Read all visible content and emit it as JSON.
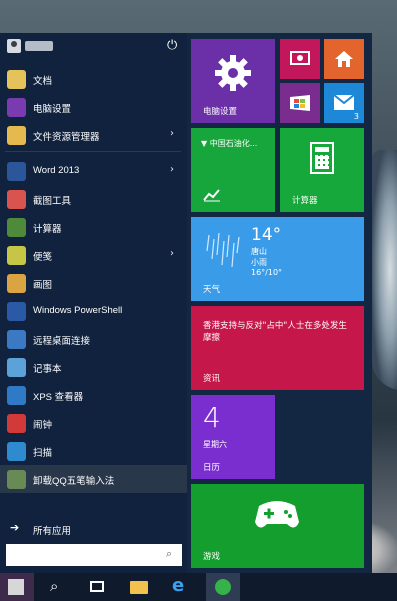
{
  "user": {
    "name_hidden": true
  },
  "menu_items": [
    {
      "label": "文档",
      "icon": "documents-icon",
      "color": "#e5c25a",
      "has_arrow": false
    },
    {
      "label": "电脑设置",
      "icon": "settings-icon",
      "color": "#7a3bb0",
      "has_arrow": false
    },
    {
      "label": "文件资源管理器",
      "icon": "file-explorer-icon",
      "color": "#e6b94f",
      "has_arrow": true
    },
    {
      "label": "Word 2013",
      "icon": "word-icon",
      "color": "#2b579a",
      "has_arrow": true
    },
    {
      "label": "截图工具",
      "icon": "snipping-tool-icon",
      "color": "#d9534f",
      "has_arrow": false
    },
    {
      "label": "计算器",
      "icon": "calculator-icon",
      "color": "#4e8a3a",
      "has_arrow": false
    },
    {
      "label": "便笺",
      "icon": "sticky-notes-icon",
      "color": "#c7c545",
      "has_arrow": true
    },
    {
      "label": "画图",
      "icon": "paint-icon",
      "color": "#d9a441",
      "has_arrow": false
    },
    {
      "label": "Windows PowerShell",
      "icon": "powershell-icon",
      "color": "#2a5aa6",
      "has_arrow": false
    },
    {
      "label": "远程桌面连接",
      "icon": "remote-desktop-icon",
      "color": "#3b79c5",
      "has_arrow": false
    },
    {
      "label": "记事本",
      "icon": "notepad-icon",
      "color": "#5aa2d8",
      "has_arrow": false
    },
    {
      "label": "XPS 查看器",
      "icon": "xps-viewer-icon",
      "color": "#2f7ac7",
      "has_arrow": false
    },
    {
      "label": "闹钟",
      "icon": "alarm-icon",
      "color": "#d23a3a",
      "has_arrow": false
    },
    {
      "label": "扫描",
      "icon": "scan-icon",
      "color": "#2e8bcf",
      "has_arrow": false
    },
    {
      "label": "卸载QQ五笔输入法",
      "icon": "uninstall-icon",
      "color": "#6a8a55",
      "has_arrow": false
    }
  ],
  "all_apps": {
    "label": "所有应用",
    "icon": "arrow-right-icon"
  },
  "search": {
    "value": "",
    "placeholder": "",
    "icon": "search-icon"
  },
  "tiles": {
    "settings": {
      "label": "电脑设置",
      "color": "#6b2fa8",
      "icon": "gear-icon"
    },
    "media": {
      "color": "#c2185b",
      "icon": "video-icon"
    },
    "home": {
      "color": "#e3652d",
      "icon": "home-icon"
    },
    "store": {
      "color": "#7b2c8f",
      "icon": "store-icon"
    },
    "mail": {
      "color": "#1e88d8",
      "icon": "mail-icon",
      "badge": "3"
    },
    "stock": {
      "headline": "▼ 中国石油化...",
      "color": "#17a63c",
      "icon": "chart-icon"
    },
    "calculator": {
      "label": "计算器",
      "color": "#16a83a",
      "icon": "calculator-icon"
    },
    "weather": {
      "label": "天气",
      "temp": "14°",
      "city": "唐山",
      "condition": "小雨",
      "range": "16°/10°",
      "color": "#3a9ce8",
      "icon": "rain-icon"
    },
    "news": {
      "label": "资讯",
      "headline": "香港支持与反对\"占中\"人士在多处发生摩擦",
      "color": "#c5174a"
    },
    "calendar": {
      "label": "日历",
      "day": "4",
      "weekday": "星期六",
      "color": "#7b2ed0"
    },
    "xbox": {
      "label": "游戏",
      "color": "#149e2e",
      "icon": "xbox-icon"
    }
  },
  "taskbar": [
    {
      "name": "start-icon"
    },
    {
      "name": "search-icon"
    },
    {
      "name": "task-view-icon"
    },
    {
      "name": "folder-icon"
    },
    {
      "name": "ie-icon"
    },
    {
      "name": "app-icon"
    }
  ]
}
